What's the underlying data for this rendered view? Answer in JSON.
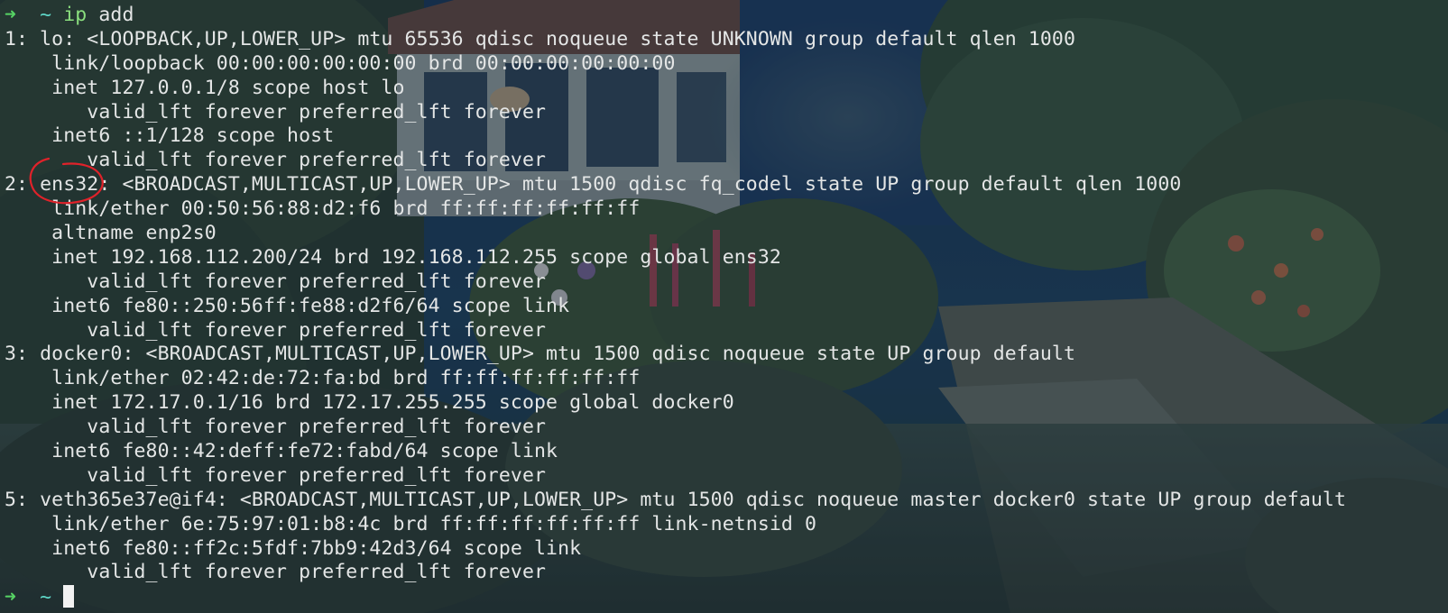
{
  "colors": {
    "background_dark": "#1e3a4e",
    "text": "#e4e6e6",
    "prompt_arrow": "#56d364",
    "prompt_tilde": "#5fd7c8",
    "annotation": "#e0222a"
  },
  "prompt": {
    "arrow": "➜",
    "cwd": "~"
  },
  "command": {
    "name": "ip",
    "args": " add"
  },
  "output": [
    "1: lo: <LOOPBACK,UP,LOWER_UP> mtu 65536 qdisc noqueue state UNKNOWN group default qlen 1000",
    "    link/loopback 00:00:00:00:00:00 brd 00:00:00:00:00:00",
    "    inet 127.0.0.1/8 scope host lo",
    "       valid_lft forever preferred_lft forever",
    "    inet6 ::1/128 scope host",
    "       valid_lft forever preferred_lft forever",
    "2: ens32: <BROADCAST,MULTICAST,UP,LOWER_UP> mtu 1500 qdisc fq_codel state UP group default qlen 1000",
    "    link/ether 00:50:56:88:d2:f6 brd ff:ff:ff:ff:ff:ff",
    "    altname enp2s0",
    "    inet 192.168.112.200/24 brd 192.168.112.255 scope global ens32",
    "       valid_lft forever preferred_lft forever",
    "    inet6 fe80::250:56ff:fe88:d2f6/64 scope link",
    "       valid_lft forever preferred_lft forever",
    "3: docker0: <BROADCAST,MULTICAST,UP,LOWER_UP> mtu 1500 qdisc noqueue state UP group default",
    "    link/ether 02:42:de:72:fa:bd brd ff:ff:ff:ff:ff:ff",
    "    inet 172.17.0.1/16 brd 172.17.255.255 scope global docker0",
    "       valid_lft forever preferred_lft forever",
    "    inet6 fe80::42:deff:fe72:fabd/64 scope link",
    "       valid_lft forever preferred_lft forever",
    "5: veth365e37e@if4: <BROADCAST,MULTICAST,UP,LOWER_UP> mtu 1500 qdisc noqueue master docker0 state UP group default",
    "    link/ether 6e:75:97:01:b8:4c brd ff:ff:ff:ff:ff:ff link-netnsid 0",
    "    inet6 fe80::ff2c:5fdf:7bb9:42d3/64 scope link",
    "       valid_lft forever preferred_lft forever"
  ]
}
